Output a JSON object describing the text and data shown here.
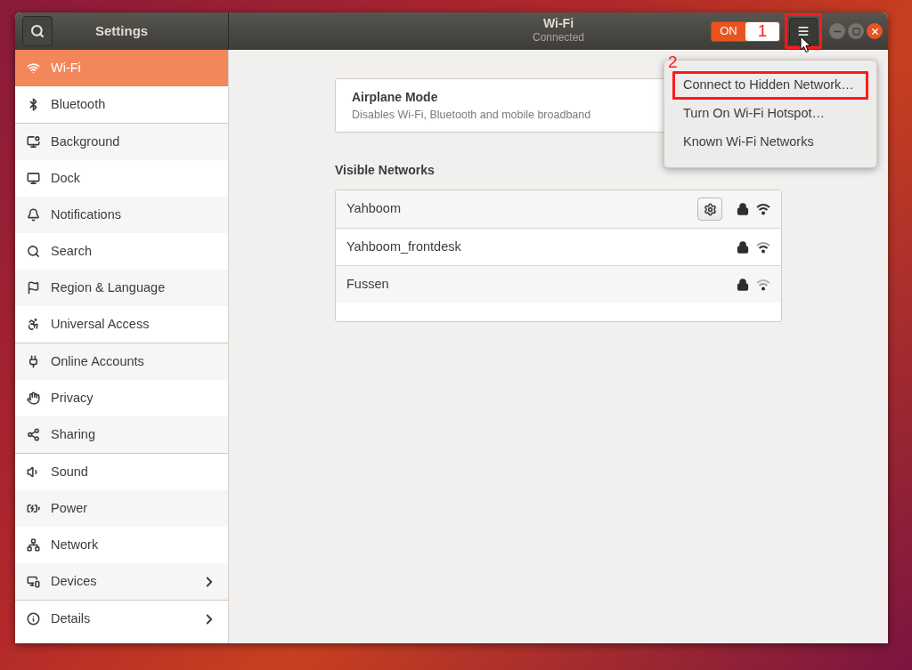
{
  "window": {
    "title": "Wi-Fi",
    "subtitle": "Connected"
  },
  "sidebar": {
    "title": "Settings",
    "groups": [
      {
        "items": [
          {
            "label": "Wi-Fi",
            "selected": true,
            "arrow": false
          },
          {
            "label": "Bluetooth",
            "selected": false,
            "arrow": false
          }
        ]
      },
      {
        "items": [
          {
            "label": "Background",
            "selected": false,
            "arrow": false
          },
          {
            "label": "Dock",
            "selected": false,
            "arrow": false
          },
          {
            "label": "Notifications",
            "selected": false,
            "arrow": false
          },
          {
            "label": "Search",
            "selected": false,
            "arrow": false
          },
          {
            "label": "Region & Language",
            "selected": false,
            "arrow": false
          },
          {
            "label": "Universal Access",
            "selected": false,
            "arrow": false
          }
        ]
      },
      {
        "items": [
          {
            "label": "Online Accounts",
            "selected": false,
            "arrow": false
          },
          {
            "label": "Privacy",
            "selected": false,
            "arrow": false
          },
          {
            "label": "Sharing",
            "selected": false,
            "arrow": false
          }
        ]
      },
      {
        "items": [
          {
            "label": "Sound",
            "selected": false,
            "arrow": false
          },
          {
            "label": "Power",
            "selected": false,
            "arrow": false
          },
          {
            "label": "Network",
            "selected": false,
            "arrow": false
          },
          {
            "label": "Devices",
            "selected": false,
            "arrow": true
          }
        ]
      },
      {
        "items": [
          {
            "label": "Details",
            "selected": false,
            "arrow": true
          }
        ]
      }
    ]
  },
  "wifi_switch": {
    "label": "ON",
    "on": true,
    "annotation": "1"
  },
  "menu_button": {
    "annotated": true
  },
  "menu": {
    "annotation": "2",
    "items": [
      {
        "label": "Connect to Hidden Network…",
        "annotated": true
      },
      {
        "label": "Turn On Wi-Fi Hotspot…",
        "annotated": false
      },
      {
        "label": "Known Wi-Fi Networks",
        "annotated": false
      }
    ]
  },
  "airplane_mode": {
    "title": "Airplane Mode",
    "description": "Disables Wi-Fi, Bluetooth and mobile broadband"
  },
  "visible_networks": {
    "title": "Visible Networks",
    "networks": [
      {
        "name": "Yahboom",
        "connected": true,
        "secured": true,
        "kind": "strong"
      },
      {
        "name": "Yahboom_frontdesk",
        "connected": false,
        "secured": true,
        "kind": "good"
      },
      {
        "name": "Fussen",
        "connected": false,
        "secured": true,
        "kind": "weak"
      }
    ]
  }
}
